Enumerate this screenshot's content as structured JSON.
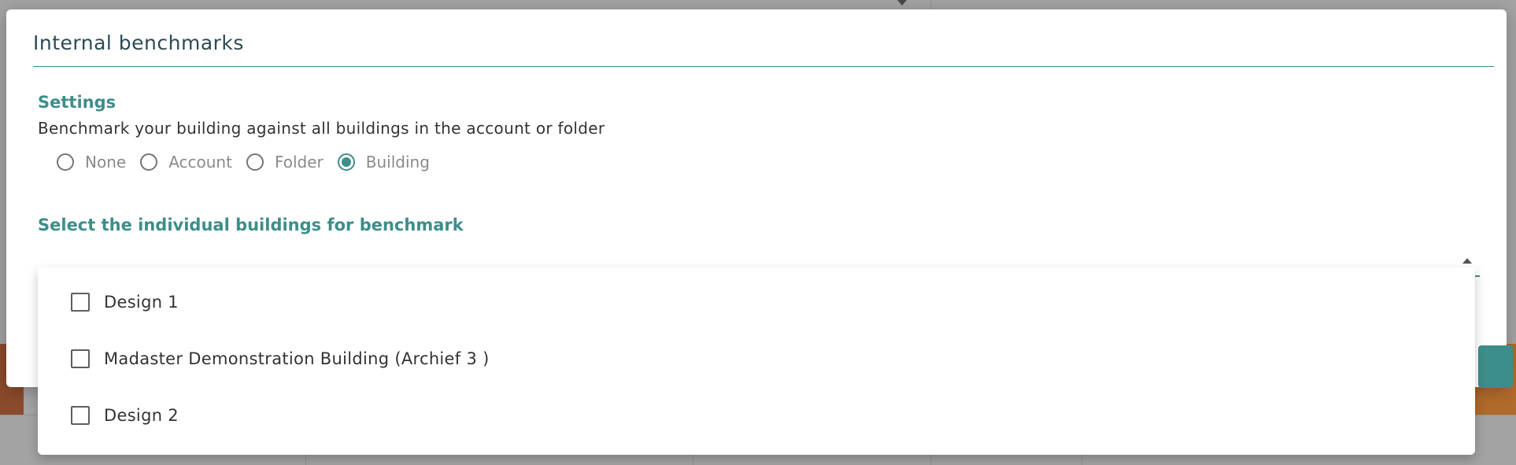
{
  "modal": {
    "title": "Internal benchmarks",
    "settings_label": "Settings",
    "description": "Benchmark your building against all buildings in the account or folder",
    "radio_options": [
      {
        "label": "None",
        "checked": false
      },
      {
        "label": "Account",
        "checked": false
      },
      {
        "label": "Folder",
        "checked": false
      },
      {
        "label": "Building",
        "checked": true
      }
    ],
    "select_label": "Select the individual buildings for benchmark",
    "select_value": ""
  },
  "dropdown": {
    "items": [
      {
        "label": "Design 1",
        "checked": false
      },
      {
        "label": "Madaster Demonstration Building (Archief 3 )",
        "checked": false
      },
      {
        "label": "Design 2",
        "checked": false
      }
    ]
  },
  "colors": {
    "accent": "#3c8e8a",
    "title": "#2c4a55",
    "overlay": "#a3a3a3"
  },
  "icons": {
    "select_arrow": "caret-up-icon",
    "radio": "radio-icon",
    "checkbox": "checkbox-icon"
  }
}
